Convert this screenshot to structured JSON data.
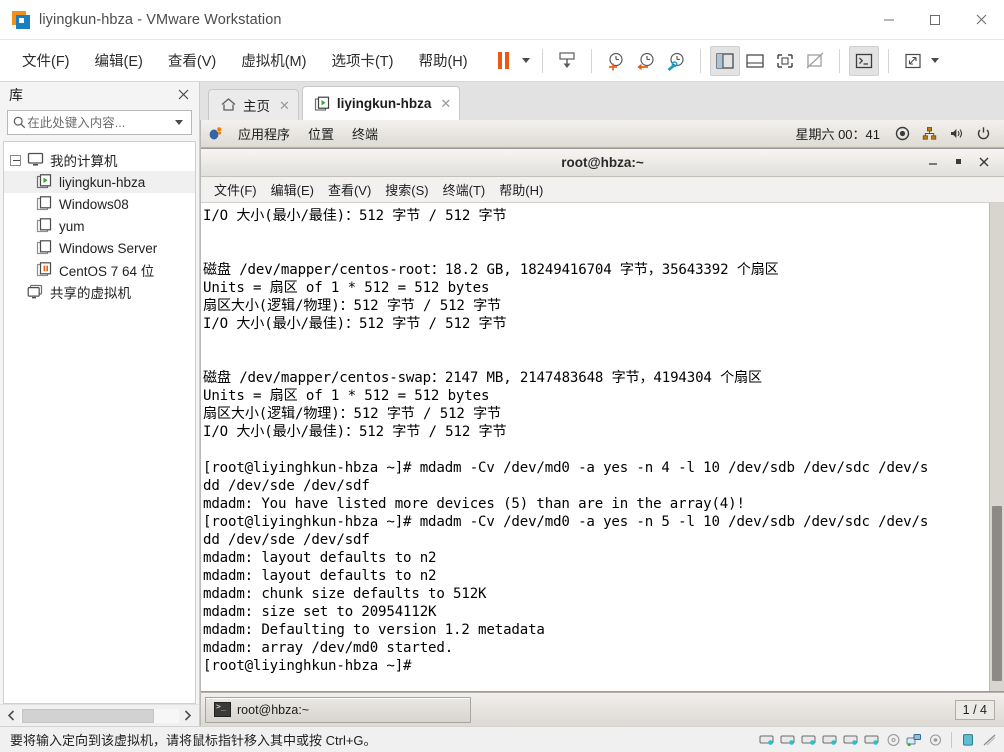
{
  "window": {
    "title": "liyingkun-hbza - VMware Workstation",
    "logo_icon": "vmware-logo-icon",
    "minimize_icon": "minimize-icon",
    "maximize_icon": "maximize-icon",
    "close_icon": "close-icon"
  },
  "menubar": {
    "items": [
      {
        "label": "文件(F)",
        "name": "menu-file"
      },
      {
        "label": "编辑(E)",
        "name": "menu-edit"
      },
      {
        "label": "查看(V)",
        "name": "menu-view"
      },
      {
        "label": "虚拟机(M)",
        "name": "menu-vm"
      },
      {
        "label": "选项卡(T)",
        "name": "menu-tabs"
      },
      {
        "label": "帮助(H)",
        "name": "menu-help"
      }
    ]
  },
  "toolbar": {
    "suspend_icon": "pause-icon",
    "suspend_caret_icon": "chevron-down-icon",
    "send_cad_icon": "send-ctrl-alt-del-icon",
    "snapshot_take_icon": "take-snapshot-icon",
    "snapshot_revert_icon": "revert-snapshot-icon",
    "snapshot_manage_icon": "manage-snapshots-icon",
    "show_library_icon": "show-library-panel-icon",
    "show_thumbnails_icon": "show-thumbnail-bar-icon",
    "full_screen_icon": "full-screen-icon",
    "unity_icon": "unity-mode-icon",
    "console_view_icon": "console-view-icon",
    "stretch_icon": "fit-guest-icon",
    "stretch_caret_icon": "chevron-down-icon"
  },
  "sidebar": {
    "title": "库",
    "close_icon": "close-icon",
    "search": {
      "icon": "search-icon",
      "value": "",
      "placeholder": "在此处键入内容...",
      "dropdown_icon": "chevron-down-icon"
    },
    "tree": [
      {
        "label": "我的计算机",
        "name": "tree-item-my-computer",
        "level": 1,
        "icon": "monitor-icon",
        "state": "expanded"
      },
      {
        "label": "liyingkun-hbza",
        "name": "tree-item-liyingkun-hbza",
        "level": 2,
        "icon": "vm-running-icon",
        "state": "running",
        "selected": true
      },
      {
        "label": "Windows08",
        "name": "tree-item-windows08",
        "level": 2,
        "icon": "vm-powered-off-icon",
        "state": "off"
      },
      {
        "label": "yum",
        "name": "tree-item-yum",
        "level": 2,
        "icon": "vm-powered-off-icon",
        "state": "off"
      },
      {
        "label": "Windows Server",
        "name": "tree-item-windows-server",
        "level": 2,
        "icon": "vm-powered-off-icon",
        "state": "off"
      },
      {
        "label": "CentOS 7 64 位",
        "name": "tree-item-centos7-64",
        "level": 2,
        "icon": "vm-suspended-icon",
        "state": "suspended"
      },
      {
        "label": "共享的虚拟机",
        "name": "tree-item-shared-vms",
        "level": 1,
        "icon": "shared-vms-icon",
        "state": "none"
      }
    ],
    "hscroll": {
      "left_icon": "chevron-left-icon",
      "right_icon": "chevron-right-icon"
    }
  },
  "tabs": [
    {
      "label": "主页",
      "name": "tab-home",
      "icon": "home-icon",
      "active": false,
      "close_icon": "close-icon"
    },
    {
      "label": "liyingkun-hbza",
      "name": "tab-liyingkun-hbza",
      "icon": "vm-running-icon",
      "active": true,
      "close_icon": "close-icon"
    }
  ],
  "guest": {
    "panel": {
      "menus": [
        {
          "label": "应用程序",
          "name": "gnome-menu-applications"
        },
        {
          "label": "位置",
          "name": "gnome-menu-places"
        },
        {
          "label": "终端",
          "name": "gnome-menu-terminal"
        }
      ],
      "foot_icon": "gnome-foot-icon",
      "clock": "星期六 00：41",
      "tray": [
        {
          "icon": "screen-recorder-icon",
          "name": "tray-recorder"
        },
        {
          "icon": "network-icon",
          "name": "tray-network"
        },
        {
          "icon": "volume-icon",
          "name": "tray-volume"
        },
        {
          "icon": "power-icon",
          "name": "tray-power"
        }
      ]
    },
    "terminal": {
      "title": "root@hbza:~",
      "minimize_icon": "minimize-icon",
      "maximize_icon": "maximize-icon",
      "close_icon": "close-icon",
      "menus": [
        {
          "label": "文件(F)",
          "name": "term-menu-file"
        },
        {
          "label": "编辑(E)",
          "name": "term-menu-edit"
        },
        {
          "label": "查看(V)",
          "name": "term-menu-view"
        },
        {
          "label": "搜索(S)",
          "name": "term-menu-search"
        },
        {
          "label": "终端(T)",
          "name": "term-menu-terminal"
        },
        {
          "label": "帮助(H)",
          "name": "term-menu-help"
        }
      ],
      "content": "I/O 大小(最小/最佳)：512 字节 / 512 字节\n\n\n磁盘 /dev/mapper/centos-root：18.2 GB, 18249416704 字节，35643392 个扇区\nUnits = 扇区 of 1 * 512 = 512 bytes\n扇区大小(逻辑/物理)：512 字节 / 512 字节\nI/O 大小(最小/最佳)：512 字节 / 512 字节\n\n\n磁盘 /dev/mapper/centos-swap：2147 MB, 2147483648 字节，4194304 个扇区\nUnits = 扇区 of 1 * 512 = 512 bytes\n扇区大小(逻辑/物理)：512 字节 / 512 字节\nI/O 大小(最小/最佳)：512 字节 / 512 字节\n\n[root@liyinghkun-hbza ~]# mdadm -Cv /dev/md0 -a yes -n 4 -l 10 /dev/sdb /dev/sdc /dev/s\ndd /dev/sde /dev/sdf\nmdadm: You have listed more devices (5) than are in the array(4)!\n[root@liyinghkun-hbza ~]# mdadm -Cv /dev/md0 -a yes -n 5 -l 10 /dev/sdb /dev/sdc /dev/s\ndd /dev/sde /dev/sdf\nmdadm: layout defaults to n2\nmdadm: layout defaults to n2\nmdadm: chunk size defaults to 512K\nmdadm: size set to 20954112K\nmdadm: Defaulting to version 1.2 metadata\nmdadm: array /dev/md0 started.\n[root@liyinghkun-hbza ~]# ",
      "scrollbar_name": "terminal-scrollbar"
    },
    "taskbar": {
      "task_label": "root@hbza:~",
      "task_icon": "terminal-icon",
      "workspace": "1 / 4"
    }
  },
  "statusbar": {
    "message": "要将输入定向到该虚拟机，请将鼠标指针移入其中或按 Ctrl+G。",
    "devices": [
      {
        "icon": "hard-disk-icon",
        "name": "status-hard-disk-1"
      },
      {
        "icon": "hard-disk-icon",
        "name": "status-hard-disk-2"
      },
      {
        "icon": "hard-disk-icon",
        "name": "status-hard-disk-3"
      },
      {
        "icon": "hard-disk-icon",
        "name": "status-hard-disk-4"
      },
      {
        "icon": "hard-disk-icon",
        "name": "status-hard-disk-5"
      },
      {
        "icon": "hard-disk-icon",
        "name": "status-hard-disk-6"
      },
      {
        "icon": "cd-dvd-icon",
        "name": "status-cd-dvd"
      },
      {
        "icon": "network-adapter-icon",
        "name": "status-network-adapter"
      },
      {
        "icon": "usb-controller-icon",
        "name": "status-usb"
      },
      {
        "icon": "printer-icon",
        "name": "status-printer"
      },
      {
        "icon": "message-log-icon",
        "name": "status-message-log"
      }
    ]
  }
}
